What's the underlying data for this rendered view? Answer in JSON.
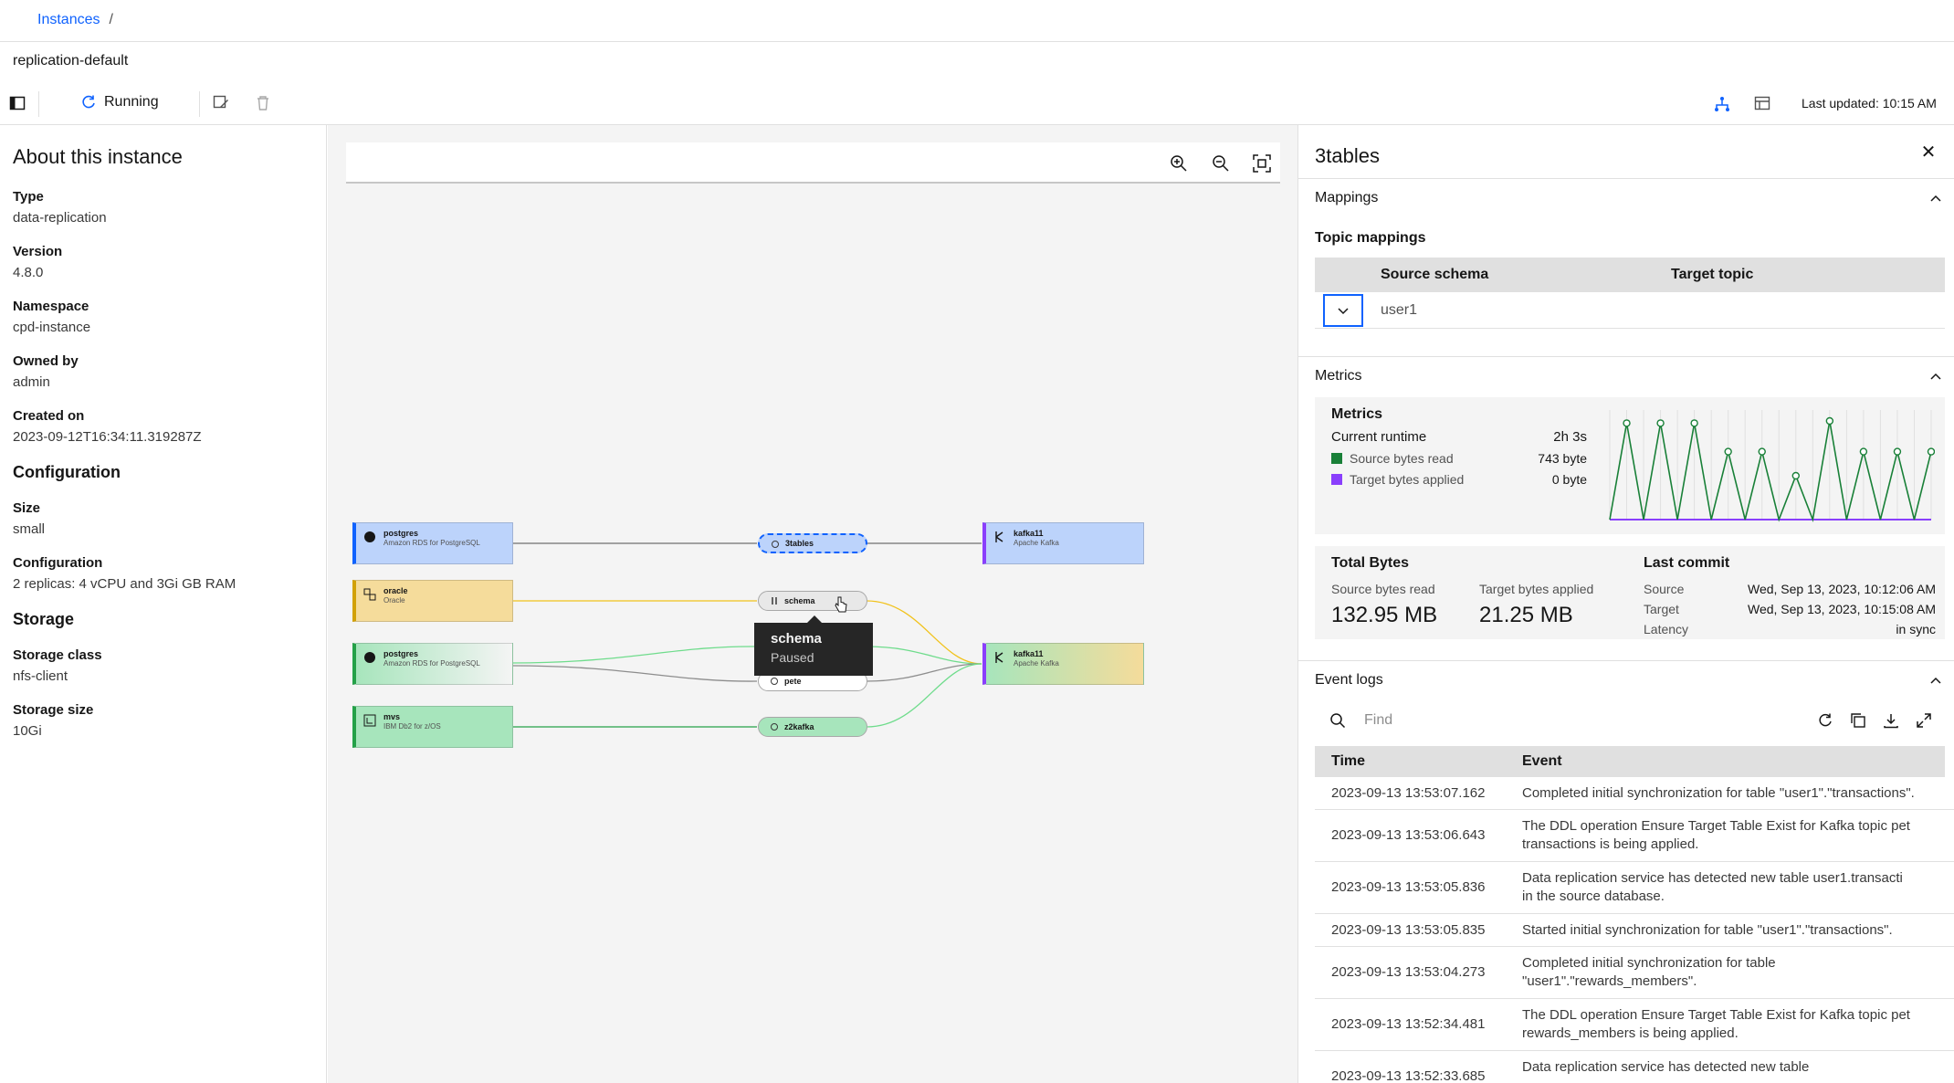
{
  "breadcrumb": {
    "link": "Instances",
    "separator": "/"
  },
  "instance": {
    "name": "replication-default"
  },
  "toolbar": {
    "status": "Running",
    "last_updated": "Last updated: 10:15 AM"
  },
  "about": {
    "heading": "About this instance",
    "fields": [
      {
        "label": "Type",
        "value": "data-replication"
      },
      {
        "label": "Version",
        "value": "4.8.0"
      },
      {
        "label": "Namespace",
        "value": "cpd-instance"
      },
      {
        "label": "Owned by",
        "value": "admin"
      },
      {
        "label": "Created on",
        "value": "2023-09-12T16:34:11.319287Z"
      }
    ],
    "configuration_heading": "Configuration",
    "configuration": [
      {
        "label": "Size",
        "value": "small"
      },
      {
        "label": "Configuration",
        "value": "2 replicas: 4 vCPU and 3Gi GB RAM"
      }
    ],
    "storage_heading": "Storage",
    "storage": [
      {
        "label": "Storage class",
        "value": "nfs-client"
      },
      {
        "label": "Storage size",
        "value": "10Gi"
      }
    ]
  },
  "canvas": {
    "sources": [
      {
        "title": "postgres",
        "subtitle": "Amazon RDS for PostgreSQL",
        "color": "#bcd3fb",
        "border": "#0f62fe"
      },
      {
        "title": "oracle",
        "subtitle": "Oracle",
        "color": "#f5dc9b",
        "border": "#d2a106"
      },
      {
        "title": "postgres",
        "subtitle": "Amazon RDS for PostgreSQL",
        "color": "#d7f0df",
        "border": "#24a148"
      },
      {
        "title": "mvs",
        "subtitle": "IBM Db2 for z/OS",
        "color": "#a7e5bc",
        "border": "#24a148"
      }
    ],
    "flows": [
      {
        "label": "3tables"
      },
      {
        "label": "schema"
      },
      {
        "label": "pete"
      },
      {
        "label": "z2kafka"
      }
    ],
    "targets": [
      {
        "title": "kafka11",
        "subtitle": "Apache Kafka"
      },
      {
        "title": "kafka11",
        "subtitle": "Apache Kafka"
      }
    ],
    "tooltip": {
      "title": "schema",
      "status": "Paused"
    }
  },
  "details": {
    "title": "3tables",
    "mappings": {
      "heading": "Mappings",
      "sub_heading": "Topic mappings",
      "columns": [
        "Source schema",
        "Target topic"
      ],
      "rows": [
        {
          "source": "user1",
          "target": ""
        }
      ]
    },
    "metrics": {
      "heading": "Metrics",
      "box_title": "Metrics",
      "runtime_label": "Current runtime",
      "runtime_value": "2h 3s",
      "source_label": "Source bytes read",
      "source_value": "743 byte",
      "target_label": "Target bytes applied",
      "target_value": "0 byte",
      "source_color": "#198038",
      "target_color": "#8a3ffc",
      "spark_source": [
        0,
        0.88,
        0,
        0.88,
        0,
        0.88,
        0,
        0.62,
        0,
        0.62,
        0,
        0.4,
        0,
        0.9,
        0,
        0.62,
        0,
        0.62,
        0,
        0.62
      ],
      "total_bytes": {
        "heading": "Total Bytes",
        "source_label": "Source bytes read",
        "source_value": "132.95 MB",
        "target_label": "Target bytes applied",
        "target_value": "21.25 MB"
      },
      "last_commit": {
        "heading": "Last commit",
        "source_label": "Source",
        "source_value": "Wed, Sep 13, 2023, 10:12:06 AM",
        "target_label": "Target",
        "target_value": "Wed, Sep 13, 2023, 10:15:08 AM",
        "latency_label": "Latency",
        "latency_value": "in sync"
      }
    },
    "event_logs": {
      "heading": "Event logs",
      "search_placeholder": "Find",
      "columns": [
        "Time",
        "Event"
      ],
      "rows": [
        {
          "time": "2023-09-13 13:53:07.162",
          "event": "Completed initial synchronization for table \"user1\".\"transactions\"."
        },
        {
          "time": "2023-09-13 13:53:06.643",
          "event": "The DDL operation Ensure Target Table Exist for Kafka topic pet\ntransactions is being applied."
        },
        {
          "time": "2023-09-13 13:53:05.836",
          "event": "Data replication service has detected new table user1.transacti\nin the source database."
        },
        {
          "time": "2023-09-13 13:53:05.835",
          "event": "Started initial synchronization for table \"user1\".\"transactions\"."
        },
        {
          "time": "2023-09-13 13:53:04.273",
          "event": "Completed initial synchronization for table\n\"user1\".\"rewards_members\"."
        },
        {
          "time": "2023-09-13 13:52:34.481",
          "event": "The DDL operation Ensure Target Table Exist for Kafka topic pet\nrewards_members is being applied."
        },
        {
          "time": "2023-09-13 13:52:33.685",
          "event": "Data replication service has detected new table"
        }
      ]
    }
  }
}
